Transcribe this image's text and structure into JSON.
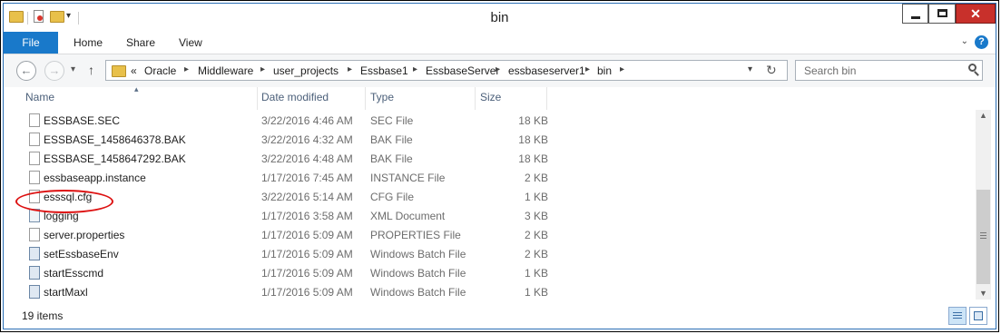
{
  "window": {
    "title": "bin"
  },
  "ribbon": {
    "tabs": [
      "File",
      "Home",
      "Share",
      "View"
    ],
    "help_glyph": "?"
  },
  "nav": {
    "breadcrumbs": [
      "«",
      "Oracle",
      "Middleware",
      "user_projects",
      "Essbase1",
      "EssbaseServer",
      "essbaseserver1",
      "bin"
    ],
    "search_placeholder": "Search bin"
  },
  "columns": {
    "name": "Name",
    "date": "Date modified",
    "type": "Type",
    "size": "Size"
  },
  "files": [
    {
      "name": "ESSBASE.SEC",
      "date": "3/22/2016 4:46 AM",
      "type": "SEC File",
      "size": "18 KB",
      "icon": "file-icon"
    },
    {
      "name": "ESSBASE_1458646378.BAK",
      "date": "3/22/2016 4:32 AM",
      "type": "BAK File",
      "size": "18 KB",
      "icon": "file-icon"
    },
    {
      "name": "ESSBASE_1458647292.BAK",
      "date": "3/22/2016 4:48 AM",
      "type": "BAK File",
      "size": "18 KB",
      "icon": "file-icon"
    },
    {
      "name": "essbaseapp.instance",
      "date": "1/17/2016 7:45 AM",
      "type": "INSTANCE File",
      "size": "2 KB",
      "icon": "file-icon"
    },
    {
      "name": "esssql.cfg",
      "date": "3/22/2016 5:14 AM",
      "type": "CFG File",
      "size": "1 KB",
      "icon": "file-icon"
    },
    {
      "name": "logging",
      "date": "1/17/2016 3:58 AM",
      "type": "XML Document",
      "size": "3 KB",
      "icon": "xml-icon"
    },
    {
      "name": "server.properties",
      "date": "1/17/2016 5:09 AM",
      "type": "PROPERTIES File",
      "size": "2 KB",
      "icon": "file-icon"
    },
    {
      "name": "setEssbaseEnv",
      "date": "1/17/2016 5:09 AM",
      "type": "Windows Batch File",
      "size": "2 KB",
      "icon": "batch-icon"
    },
    {
      "name": "startEsscmd",
      "date": "1/17/2016 5:09 AM",
      "type": "Windows Batch File",
      "size": "1 KB",
      "icon": "batch-icon"
    },
    {
      "name": "startMaxl",
      "date": "1/17/2016 5:09 AM",
      "type": "Windows Batch File",
      "size": "1 KB",
      "icon": "batch-icon"
    }
  ],
  "status": {
    "item_count": "19 items"
  },
  "colors": {
    "accent": "#1979ca",
    "highlight_circle": "#dd1111"
  }
}
